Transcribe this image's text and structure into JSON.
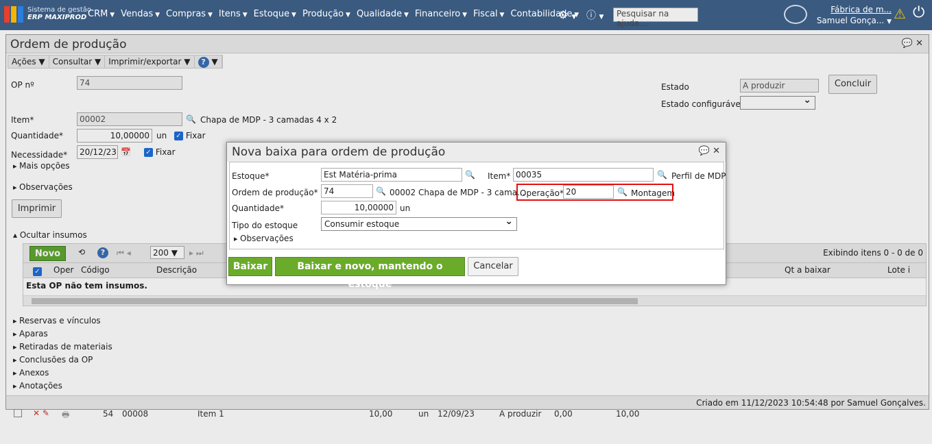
{
  "topbar": {
    "brand_line1": "Sistema de gestão",
    "brand_line2": "ERP MAXIPROD",
    "menu": [
      "CRM",
      "Vendas",
      "Compras",
      "Itens",
      "Estoque",
      "Produção",
      "Qualidade",
      "Financeiro",
      "Fiscal",
      "Contabilidade"
    ],
    "search_placeholder": "Pesquisar na ajuda...",
    "company": "Fábrica de m...",
    "user": "Samuel Gonça..."
  },
  "window": {
    "title": "Ordem de produção",
    "toolbar": [
      "Ações ▼",
      "Consultar ▼",
      "Imprimir/exportar ▼"
    ],
    "op_label": "OP nº",
    "op_value": "74",
    "estado_label": "Estado",
    "estado_value": "A produzir",
    "estado_conf_label": "Estado configurável",
    "concluir": "Concluir",
    "item_label": "Item*",
    "item_value": "00002",
    "item_desc": "Chapa de MDP - 3 camadas 4 x 2",
    "qtd_label": "Quantidade*",
    "qtd_value": "10,00000",
    "qtd_unit": "un",
    "fixar": "Fixar",
    "nec_label": "Necessidade*",
    "nec_value": "20/12/23",
    "mais_opcoes": "Mais opções",
    "observacoes": "Observações",
    "imprimir": "Imprimir",
    "ocultar_insumos": "Ocultar insumos",
    "grid": {
      "novo": "Novo",
      "page_size": "200",
      "exibindo": "Exibindo itens 0 - 0 de 0",
      "columns": [
        "Oper",
        "Código",
        "Descrição",
        "Qt a baixar",
        "Lote i"
      ],
      "empty": "Esta OP não tem insumos."
    },
    "sections": [
      "Reservas e vínculos",
      "Aparas",
      "Retiradas de materiais",
      "Conclusões da OP",
      "Anexos",
      "Anotações"
    ],
    "footer": "Criado em 11/12/2023 10:54:48 por Samuel Gonçalves."
  },
  "background_rows": [
    {
      "num": "54",
      "code": "00008",
      "desc": "Item 1",
      "qty": "10,00",
      "unit": "un",
      "date": "12/09/23",
      "status": "A produzir",
      "v1": "0,00",
      "v2": "10,00"
    }
  ],
  "modal": {
    "title": "Nova baixa para ordem de produção",
    "estoque_label": "Estoque*",
    "estoque_value": "Est Matéria-prima",
    "item_label": "Item*",
    "item_value": "00035",
    "item_desc": "Perfil de MDP",
    "ordem_label": "Ordem de produção*",
    "ordem_value": "74",
    "ordem_desc": "00002 Chapa de MDP - 3 cama...",
    "operacao_label": "Operação*",
    "operacao_value": "20",
    "operacao_desc": "Montagem",
    "quantidade_label": "Quantidade*",
    "quantidade_value": "10,00000",
    "quantidade_unit": "un",
    "tipo_label": "Tipo do estoque",
    "tipo_value": "Consumir estoque",
    "observacoes": "Observações",
    "btn_baixar": "Baixar",
    "btn_baixar_novo": "Baixar e novo, mantendo o estoque",
    "btn_cancelar": "Cancelar"
  }
}
